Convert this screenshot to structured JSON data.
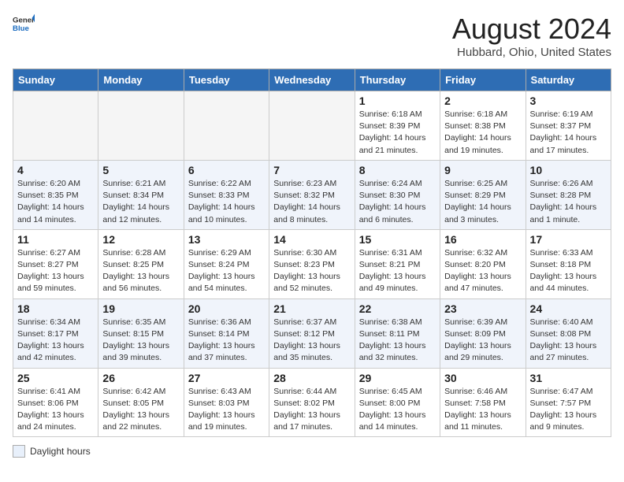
{
  "header": {
    "logo_general": "General",
    "logo_blue": "Blue",
    "title": "August 2024",
    "subtitle": "Hubbard, Ohio, United States"
  },
  "days_of_week": [
    "Sunday",
    "Monday",
    "Tuesday",
    "Wednesday",
    "Thursday",
    "Friday",
    "Saturday"
  ],
  "weeks": [
    [
      {
        "day": "",
        "info": ""
      },
      {
        "day": "",
        "info": ""
      },
      {
        "day": "",
        "info": ""
      },
      {
        "day": "",
        "info": ""
      },
      {
        "day": "1",
        "info": "Sunrise: 6:18 AM\nSunset: 8:39 PM\nDaylight: 14 hours and 21 minutes."
      },
      {
        "day": "2",
        "info": "Sunrise: 6:18 AM\nSunset: 8:38 PM\nDaylight: 14 hours and 19 minutes."
      },
      {
        "day": "3",
        "info": "Sunrise: 6:19 AM\nSunset: 8:37 PM\nDaylight: 14 hours and 17 minutes."
      }
    ],
    [
      {
        "day": "4",
        "info": "Sunrise: 6:20 AM\nSunset: 8:35 PM\nDaylight: 14 hours and 14 minutes."
      },
      {
        "day": "5",
        "info": "Sunrise: 6:21 AM\nSunset: 8:34 PM\nDaylight: 14 hours and 12 minutes."
      },
      {
        "day": "6",
        "info": "Sunrise: 6:22 AM\nSunset: 8:33 PM\nDaylight: 14 hours and 10 minutes."
      },
      {
        "day": "7",
        "info": "Sunrise: 6:23 AM\nSunset: 8:32 PM\nDaylight: 14 hours and 8 minutes."
      },
      {
        "day": "8",
        "info": "Sunrise: 6:24 AM\nSunset: 8:30 PM\nDaylight: 14 hours and 6 minutes."
      },
      {
        "day": "9",
        "info": "Sunrise: 6:25 AM\nSunset: 8:29 PM\nDaylight: 14 hours and 3 minutes."
      },
      {
        "day": "10",
        "info": "Sunrise: 6:26 AM\nSunset: 8:28 PM\nDaylight: 14 hours and 1 minute."
      }
    ],
    [
      {
        "day": "11",
        "info": "Sunrise: 6:27 AM\nSunset: 8:27 PM\nDaylight: 13 hours and 59 minutes."
      },
      {
        "day": "12",
        "info": "Sunrise: 6:28 AM\nSunset: 8:25 PM\nDaylight: 13 hours and 56 minutes."
      },
      {
        "day": "13",
        "info": "Sunrise: 6:29 AM\nSunset: 8:24 PM\nDaylight: 13 hours and 54 minutes."
      },
      {
        "day": "14",
        "info": "Sunrise: 6:30 AM\nSunset: 8:23 PM\nDaylight: 13 hours and 52 minutes."
      },
      {
        "day": "15",
        "info": "Sunrise: 6:31 AM\nSunset: 8:21 PM\nDaylight: 13 hours and 49 minutes."
      },
      {
        "day": "16",
        "info": "Sunrise: 6:32 AM\nSunset: 8:20 PM\nDaylight: 13 hours and 47 minutes."
      },
      {
        "day": "17",
        "info": "Sunrise: 6:33 AM\nSunset: 8:18 PM\nDaylight: 13 hours and 44 minutes."
      }
    ],
    [
      {
        "day": "18",
        "info": "Sunrise: 6:34 AM\nSunset: 8:17 PM\nDaylight: 13 hours and 42 minutes."
      },
      {
        "day": "19",
        "info": "Sunrise: 6:35 AM\nSunset: 8:15 PM\nDaylight: 13 hours and 39 minutes."
      },
      {
        "day": "20",
        "info": "Sunrise: 6:36 AM\nSunset: 8:14 PM\nDaylight: 13 hours and 37 minutes."
      },
      {
        "day": "21",
        "info": "Sunrise: 6:37 AM\nSunset: 8:12 PM\nDaylight: 13 hours and 35 minutes."
      },
      {
        "day": "22",
        "info": "Sunrise: 6:38 AM\nSunset: 8:11 PM\nDaylight: 13 hours and 32 minutes."
      },
      {
        "day": "23",
        "info": "Sunrise: 6:39 AM\nSunset: 8:09 PM\nDaylight: 13 hours and 29 minutes."
      },
      {
        "day": "24",
        "info": "Sunrise: 6:40 AM\nSunset: 8:08 PM\nDaylight: 13 hours and 27 minutes."
      }
    ],
    [
      {
        "day": "25",
        "info": "Sunrise: 6:41 AM\nSunset: 8:06 PM\nDaylight: 13 hours and 24 minutes."
      },
      {
        "day": "26",
        "info": "Sunrise: 6:42 AM\nSunset: 8:05 PM\nDaylight: 13 hours and 22 minutes."
      },
      {
        "day": "27",
        "info": "Sunrise: 6:43 AM\nSunset: 8:03 PM\nDaylight: 13 hours and 19 minutes."
      },
      {
        "day": "28",
        "info": "Sunrise: 6:44 AM\nSunset: 8:02 PM\nDaylight: 13 hours and 17 minutes."
      },
      {
        "day": "29",
        "info": "Sunrise: 6:45 AM\nSunset: 8:00 PM\nDaylight: 13 hours and 14 minutes."
      },
      {
        "day": "30",
        "info": "Sunrise: 6:46 AM\nSunset: 7:58 PM\nDaylight: 13 hours and 11 minutes."
      },
      {
        "day": "31",
        "info": "Sunrise: 6:47 AM\nSunset: 7:57 PM\nDaylight: 13 hours and 9 minutes."
      }
    ]
  ],
  "footer": {
    "box_label": "Daylight hours"
  }
}
